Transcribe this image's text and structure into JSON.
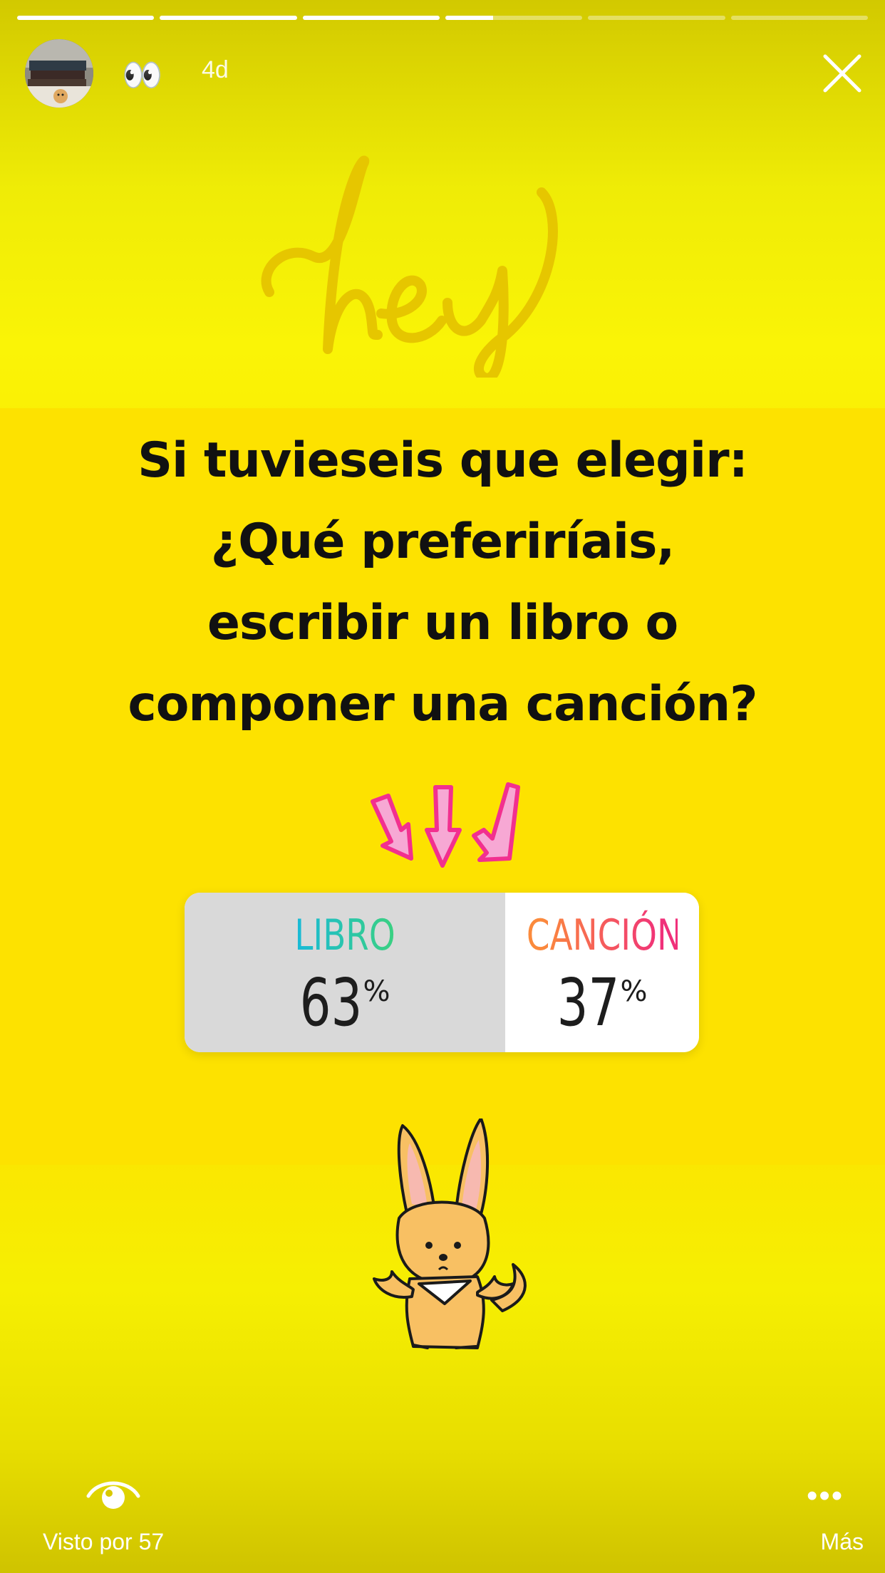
{
  "story": {
    "segments": [
      1,
      1,
      1,
      0.35,
      0,
      0
    ],
    "time": "4d",
    "emoji": "👀",
    "close_icon": "close-icon"
  },
  "sticker": {
    "hey": "hey"
  },
  "question": {
    "lines": [
      "Si tuvieseis que elegir:",
      "¿Qué preferiríais,",
      "escribir un libro o",
      "componer una canción?"
    ]
  },
  "poll": {
    "options": [
      {
        "label": "LIBRO",
        "percent": "63",
        "sign": "%"
      },
      {
        "label": "CANCIÓN",
        "percent": "37",
        "sign": "%"
      }
    ],
    "colors": {
      "libro": "#10b4ee",
      "cancion": "#fb8a3c",
      "selected_bg": "#d9d9d9"
    }
  },
  "footer": {
    "viewers_label": "Visto por 57",
    "more_label": "Más"
  },
  "colors": {
    "background": "#fce300",
    "accent_pink": "#f24aa0"
  }
}
